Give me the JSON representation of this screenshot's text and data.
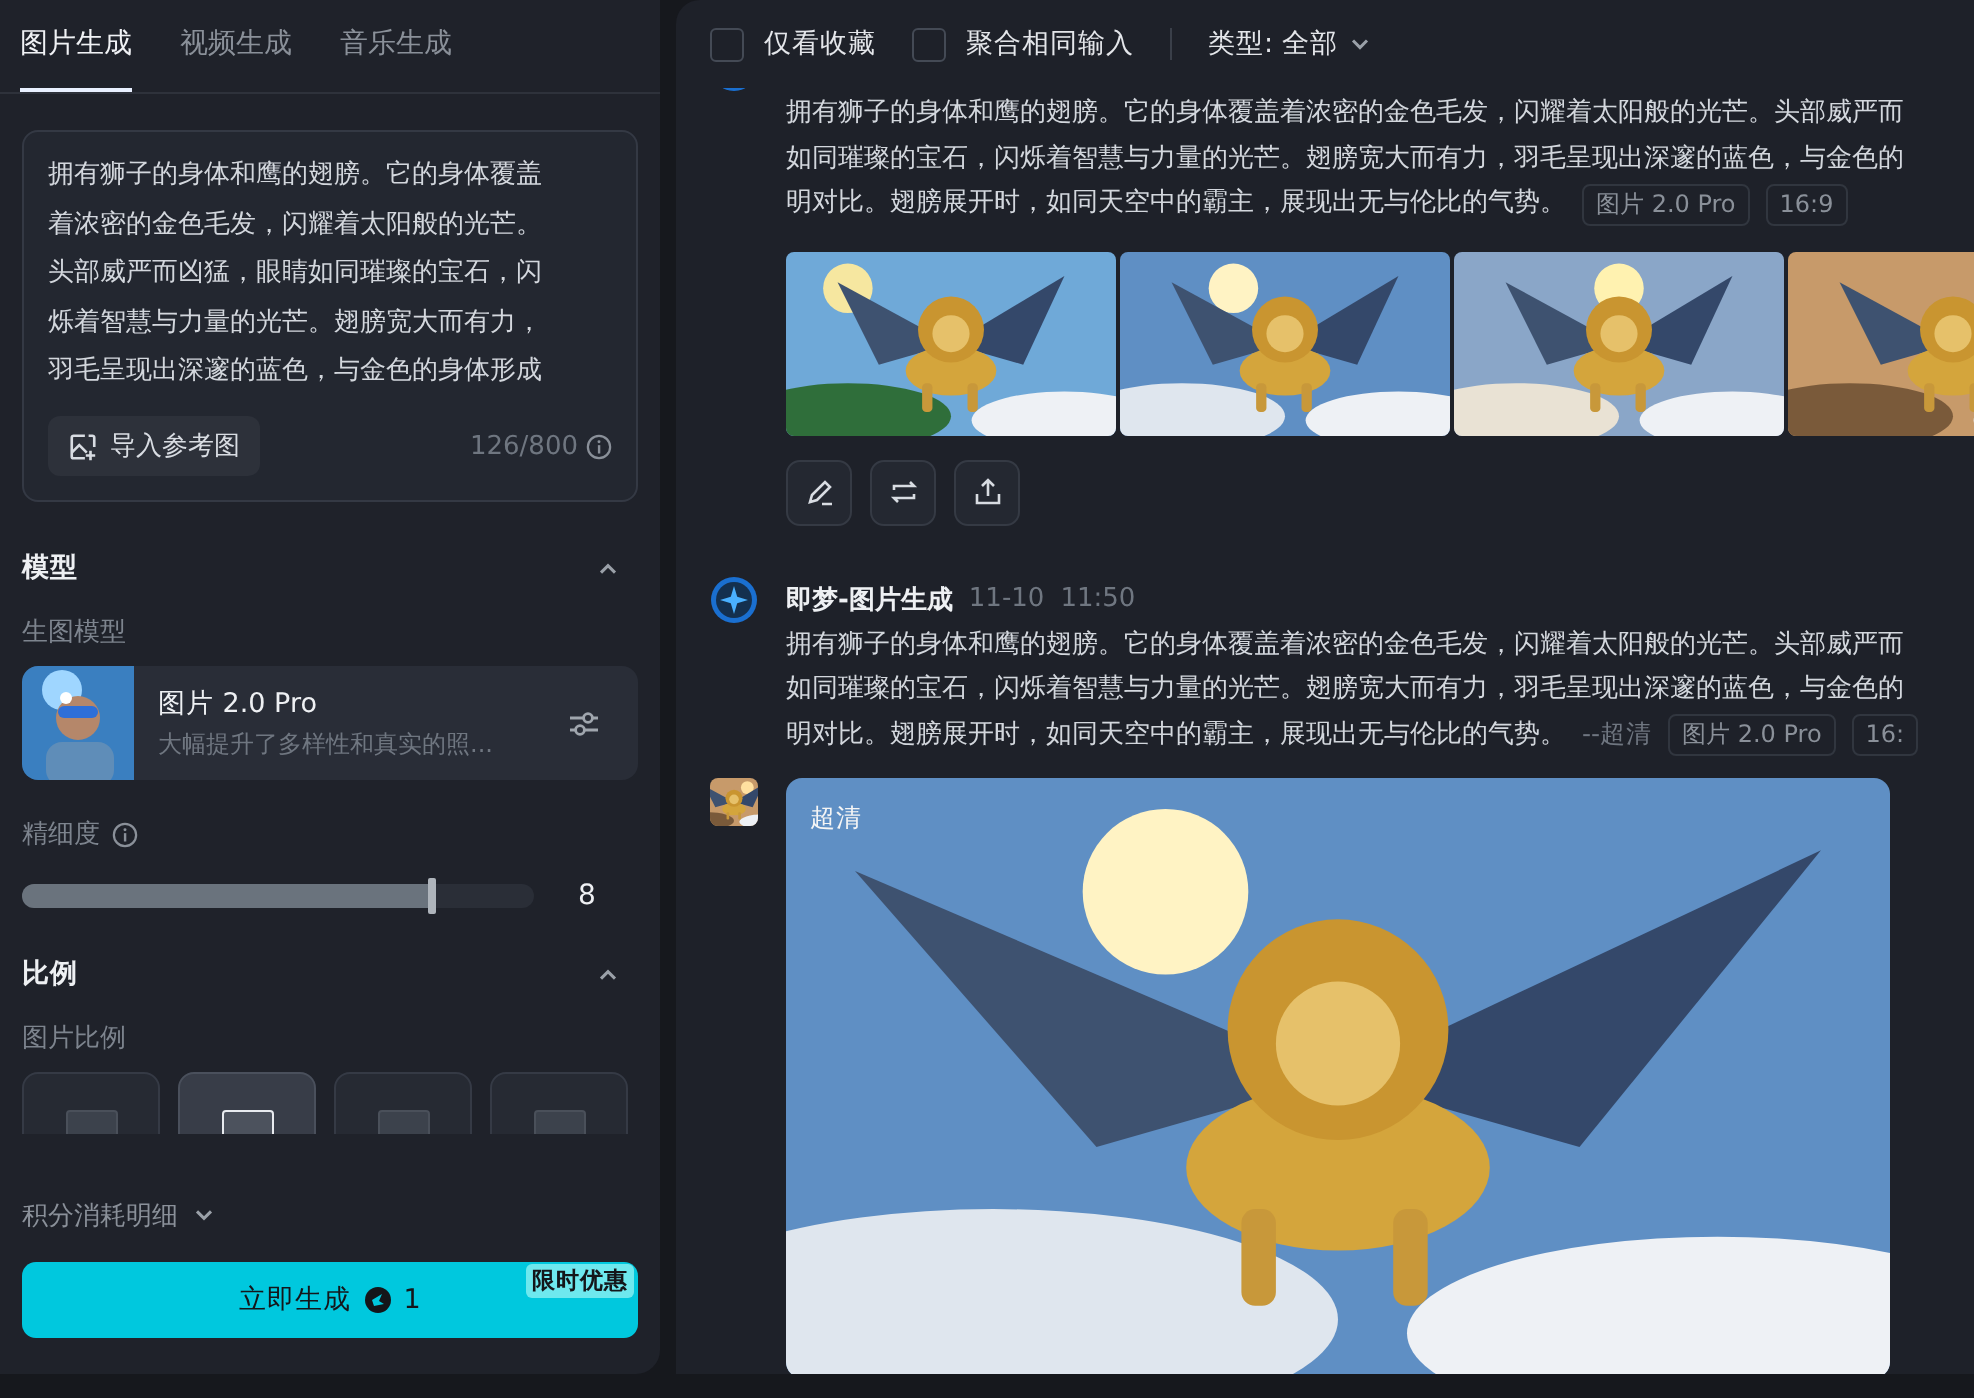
{
  "sidebar": {
    "tabs": [
      {
        "label": "图片生成",
        "selected": true
      },
      {
        "label": "视频生成",
        "selected": false
      },
      {
        "label": "音乐生成",
        "selected": false
      }
    ],
    "prompt": {
      "lines": [
        "拥有狮子的身体和鹰的翅膀。它的身体覆盖",
        "着浓密的金色毛发，闪耀着太阳般的光芒。",
        "头部威严而凶猛，眼睛如同璀璨的宝石，闪",
        "烁着智慧与力量的光芒。翅膀宽大而有力，",
        "羽毛呈现出深邃的蓝色，与金色的身体形成"
      ],
      "import_button": "导入参考图",
      "counter": "126/800"
    },
    "model_section": {
      "title": "模型",
      "expanded": true,
      "label": "生图模型",
      "model": {
        "name": "图片 2.0 Pro",
        "description": "大幅提升了多样性和真实的照..."
      }
    },
    "detail": {
      "label": "精细度",
      "level": 0.8,
      "value": "8"
    },
    "ratio_section": {
      "title": "比例",
      "expanded": true,
      "label": "图片比例",
      "options": [
        {
          "selected": false
        },
        {
          "selected": true
        },
        {
          "selected": false
        },
        {
          "selected": false
        }
      ]
    },
    "cost_details": {
      "label": "积分消耗明细",
      "expanded": false
    },
    "generate": {
      "label": "立即生成",
      "cost": "1",
      "badge": "限时优惠"
    }
  },
  "toolbar": {
    "filters": [
      {
        "label": "仅看收藏",
        "checked": false
      },
      {
        "label": "聚合相同输入",
        "checked": false
      }
    ],
    "type_filter": "类型: 全部"
  },
  "messages": [
    {
      "kind": "grid",
      "lines": [
        "拥有狮子的身体和鹰的翅膀。它的身体覆盖着浓密的金色毛发，闪耀着太阳般的光芒。头部威严而",
        "如同璀璨的宝石，闪烁着智慧与力量的光芒。翅膀宽大而有力，羽毛呈现出深邃的蓝色，与金色的",
        "明对比。翅膀展开时，如同天空中的霸主，展现出无与伦比的气势。"
      ],
      "tags": [
        "图片 2.0 Pro",
        "16:9"
      ],
      "images": [
        {
          "kind": "picture"
        },
        {
          "kind": "picture"
        },
        {
          "kind": "picture"
        },
        {
          "kind": "picture"
        }
      ]
    },
    {
      "kind": "single",
      "sender": "即梦-图片生成",
      "date": "11-10",
      "time": "11:50",
      "lines": [
        "拥有狮子的身体和鹰的翅膀。它的身体覆盖着浓密的金色毛发，闪耀着太阳般的光芒。头部威严而",
        "如同璀璨的宝石，闪烁着智慧与力量的光芒。翅膀宽大而有力，羽毛呈现出深邃的蓝色，与金色的",
        "明对比。翅膀展开时，如同天空中的霸主，展现出无与伦比的气势。"
      ],
      "suffix": "--超清",
      "tags": [
        "图片 2.0 Pro",
        "16:"
      ],
      "image_label": "超清"
    }
  ]
}
